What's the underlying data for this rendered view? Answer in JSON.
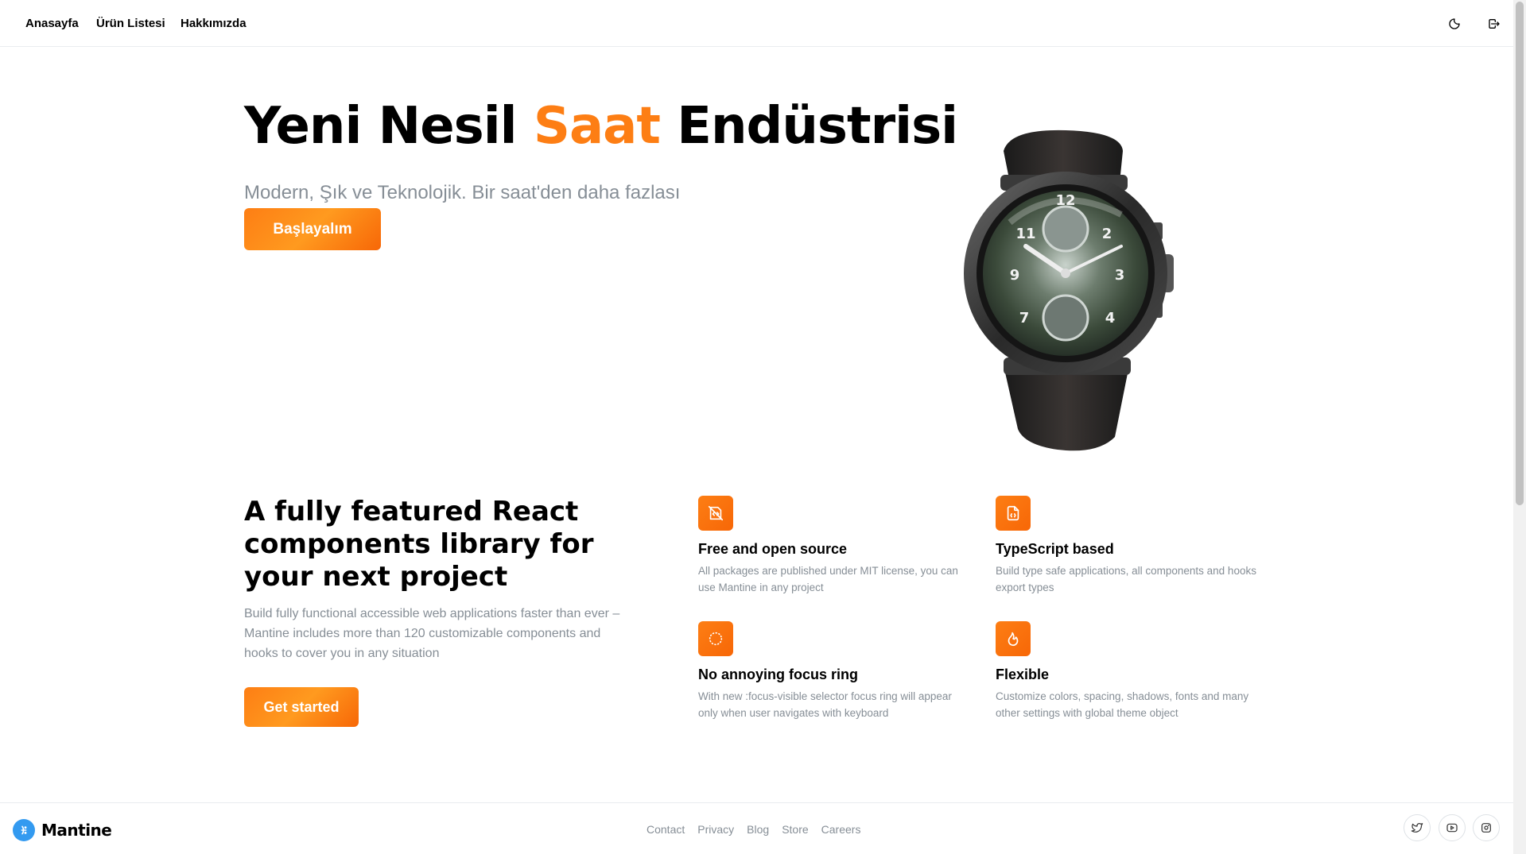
{
  "header": {
    "nav": [
      "Anasayfa",
      "Ürün Listesi",
      "Hakkımızda"
    ],
    "icons": [
      "moon-icon",
      "logout-icon"
    ]
  },
  "hero": {
    "title_part1": "Yeni Nesil ",
    "title_accent": "Saat",
    "title_part2": " Endüstrisi",
    "subtitle": "Modern, Şık ve Teknolojik. Bir saat'den daha fazlası",
    "cta": "Başlayalım",
    "accent_color": "#fd7e14"
  },
  "features_section": {
    "title": "A fully featured React components library for your next project",
    "description": "Build fully functional accessible web applications faster than ever – Mantine includes more than 120 customizable components and hooks to cover you in any situation",
    "cta": "Get started",
    "features": [
      {
        "icon": "file-code-off-icon",
        "title": "Free and open source",
        "description": "All packages are published under MIT license, you can use Mantine in any project"
      },
      {
        "icon": "file-code-icon",
        "title": "TypeScript based",
        "description": "Build type safe applications, all components and hooks export types"
      },
      {
        "icon": "circle-dotted-icon",
        "title": "No annoying focus ring",
        "description": "With new :focus-visible selector focus ring will appear only when user navigates with keyboard"
      },
      {
        "icon": "flame-icon",
        "title": "Flexible",
        "description": "Customize colors, spacing, shadows, fonts and many other settings with global theme object"
      }
    ]
  },
  "footer": {
    "brand": "Mantine",
    "links": [
      "Contact",
      "Privacy",
      "Blog",
      "Store",
      "Careers"
    ],
    "social_icons": [
      "twitter-icon",
      "youtube-icon",
      "instagram-icon"
    ]
  }
}
